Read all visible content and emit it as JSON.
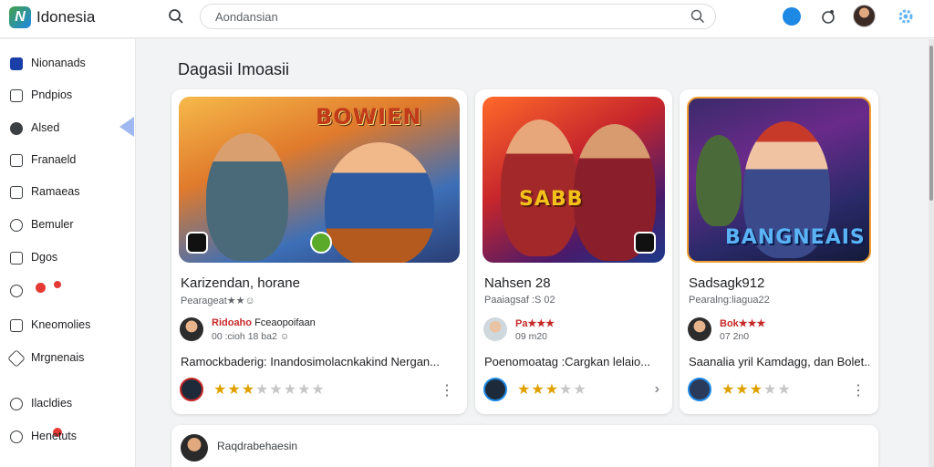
{
  "topbar": {
    "brand": "Idonesia",
    "search_placeholder": "Aondansian"
  },
  "sidebar": {
    "items": [
      {
        "label": "Nionanads",
        "icon": "home-icon"
      },
      {
        "label": "Pndpios",
        "icon": "list-icon"
      },
      {
        "label": "Alsed",
        "icon": "chat-icon"
      },
      {
        "label": "Franaeld",
        "icon": "card-icon"
      },
      {
        "label": "Ramaeas",
        "icon": "apps-icon"
      },
      {
        "label": "Bemuler",
        "icon": "gamepad-icon"
      },
      {
        "label": "Dgos",
        "icon": "square-icon"
      },
      {
        "label": "",
        "icon": "shield-icon"
      },
      {
        "label": "Kneomolies",
        "icon": "nodes-icon"
      },
      {
        "label": "Mrgnenais",
        "icon": "diamond-icon"
      },
      {
        "label": "Ilacldies",
        "icon": "gear-icon"
      },
      {
        "label": "Henetuts",
        "icon": "help-icon"
      }
    ]
  },
  "main": {
    "section_title": "Dagasii Imoasii",
    "cards": [
      {
        "art_banner": "BOWIEN",
        "title": "Karizendan, horane",
        "subtitle": "Pearageat★★☺",
        "reviewer_name": "Ridoaho",
        "reviewer_extra": "Fceaopoifaan",
        "reviewer_meta": "00 :cioh  18 ba2 ☺",
        "description": "Ramockbaderig: Inandosimolacnkakind Nergan...",
        "rating": 3,
        "more": "⋮"
      },
      {
        "art_banner": "SABB",
        "title": "Nahsen 28",
        "subtitle": "Paaiagsaf :S 02",
        "reviewer_name": "Pa★★★",
        "reviewer_extra": "",
        "reviewer_meta": "09 m20",
        "description": "Poenomoatag :Cargkan lelaio...",
        "rating": 3,
        "more": "›"
      },
      {
        "art_banner": "BANGNEAIS",
        "title": "Sadsagk912",
        "subtitle": "Pearalng:liagua22",
        "reviewer_name": "Bok★★★",
        "reviewer_extra": "",
        "reviewer_meta": "07 2n0",
        "description": "Saanalia yril Kamdagg, dan Bolet...",
        "rating": 3,
        "more": "⋮"
      }
    ],
    "comment": {
      "name": "Raqdrabehaesin"
    }
  }
}
